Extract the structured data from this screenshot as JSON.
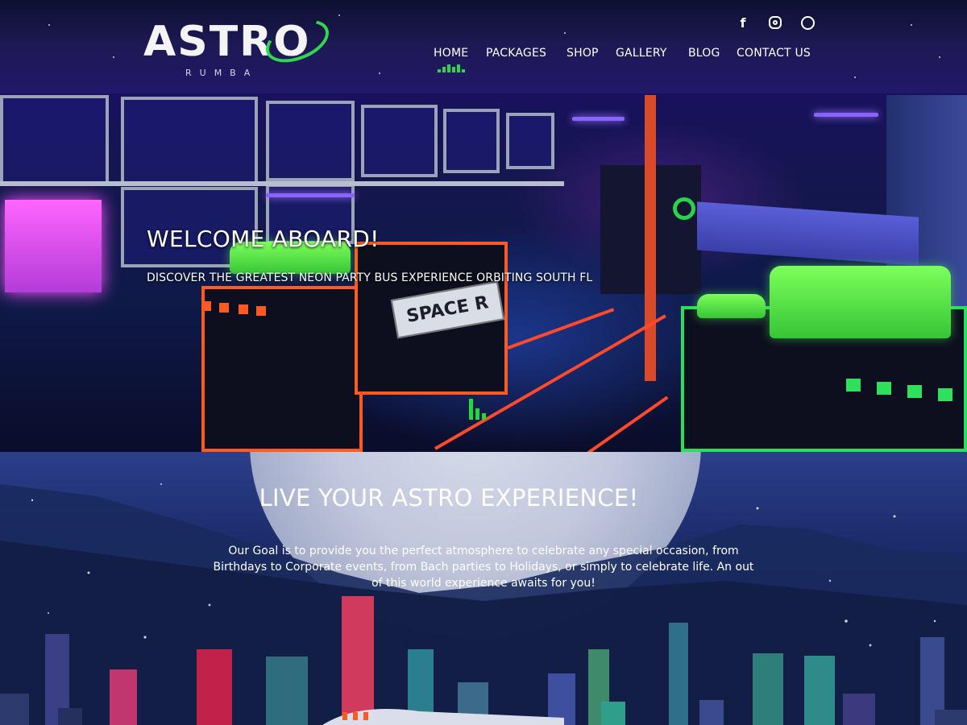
{
  "brand": {
    "name": "ASTRO",
    "tagline": "RUMBA"
  },
  "social": [
    {
      "name": "facebook",
      "icon": "facebook-icon",
      "glyph": "f"
    },
    {
      "name": "instagram",
      "icon": "instagram-icon"
    },
    {
      "name": "whatsapp",
      "icon": "whatsapp-icon"
    }
  ],
  "nav": {
    "items": [
      {
        "label": "HOME",
        "active": true
      },
      {
        "label": "PACKAGES",
        "active": false
      },
      {
        "label": "SHOP",
        "active": false
      },
      {
        "label": "GALLERY",
        "active": false
      },
      {
        "label": "BLOG",
        "active": false
      },
      {
        "label": "CONTACT US",
        "active": false
      }
    ]
  },
  "hero": {
    "title": "WELCOME ABOARD!",
    "subtitle": "DISCOVER THE GREATEST NEON PARTY BUS EXPERIENCE ORBITING SOUTH FL",
    "plate_text": "SPACE R"
  },
  "experience": {
    "title": "LIVE YOUR ASTRO EXPERIENCE!",
    "body": "Our Goal is to provide you the perfect atmosphere to celebrate any special occasion, from Birthdays to Corporate events, from Bach parties to Holidays, or simply to celebrate life. An out of this world experience awaits for you!"
  },
  "colors": {
    "accent_green": "#29d94a",
    "neon_orange": "#ff5a1f",
    "neon_pink": "#ff57ff",
    "neon_purple": "#8a63ff"
  }
}
